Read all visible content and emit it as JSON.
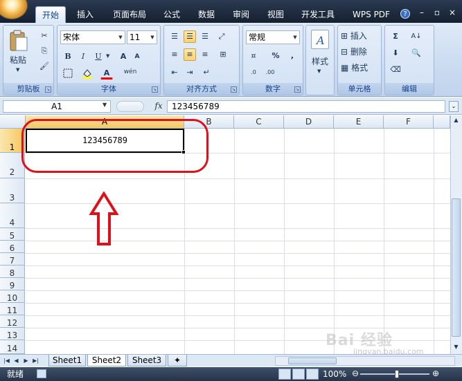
{
  "ribbon_tabs": [
    "开始",
    "插入",
    "页面布局",
    "公式",
    "数据",
    "审阅",
    "视图",
    "开发工具",
    "WPS PDF"
  ],
  "clipboard": {
    "paste_label": "粘贴",
    "group_label": "剪贴板"
  },
  "font": {
    "name": "宋体",
    "size": "11",
    "bold": "B",
    "italic": "I",
    "underline": "U",
    "grow": "A",
    "shrink": "A",
    "font_color_letter": "A",
    "phonetic": "wén",
    "group_label": "字体"
  },
  "alignment": {
    "group_label": "对齐方式"
  },
  "number": {
    "format": "常规",
    "percent": "%",
    "comma": ",",
    "group_label": "数字"
  },
  "styles": {
    "label": "样式"
  },
  "cells": {
    "insert": "插入",
    "delete": "删除",
    "format": "格式",
    "group_label": "单元格"
  },
  "editing": {
    "sum": "Σ",
    "group_label": "编辑"
  },
  "formula_bar": {
    "name_box": "A1",
    "fx": "fx",
    "value": "123456789"
  },
  "columns": [
    "A",
    "B",
    "C",
    "D",
    "E",
    "F"
  ],
  "rows": [
    "1",
    "2",
    "3",
    "4",
    "5",
    "6",
    "7",
    "8",
    "9",
    "10",
    "11",
    "12",
    "13",
    "14"
  ],
  "cell_a1": "123456789",
  "sheets": [
    "Sheet1",
    "Sheet2",
    "Sheet3"
  ],
  "active_sheet": "Sheet2",
  "status": {
    "text": "就绪",
    "zoom": "100%"
  },
  "watermark": {
    "text": "Bai 经验",
    "sub": "jingyan.baidu.com"
  },
  "colors": {
    "annotation": "#e0101a",
    "selected_header": "#f6c75d"
  }
}
